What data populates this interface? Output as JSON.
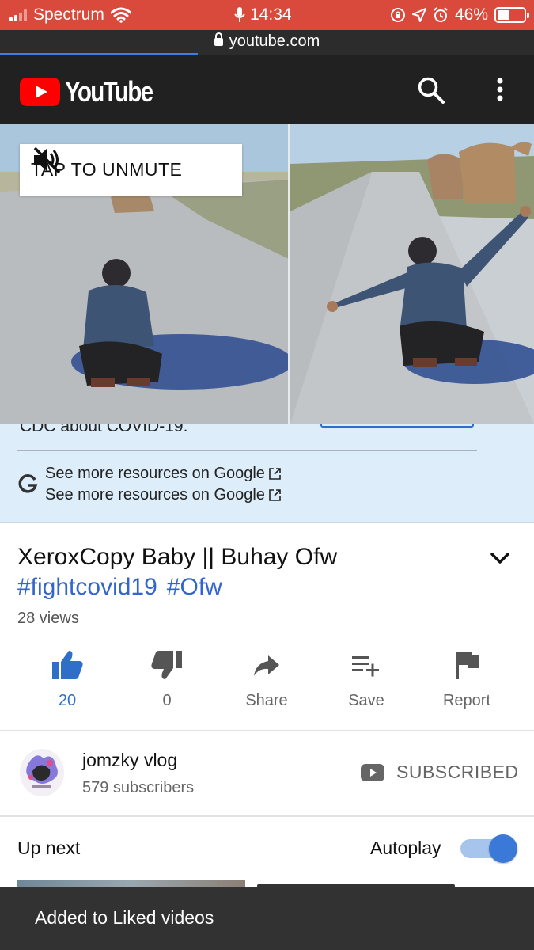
{
  "status_bar": {
    "carrier": "Spectrum",
    "time": "14:34",
    "battery_percent": "46%",
    "battery_level": 0.46,
    "icons": [
      "signal-icon",
      "wifi-icon",
      "mic-icon",
      "rotation-lock-icon",
      "location-icon",
      "alarm-icon",
      "battery-icon"
    ]
  },
  "browser": {
    "url": "youtube.com",
    "load_progress": 0.37
  },
  "header": {
    "logo_text": "YouTube",
    "icons": [
      "youtube-play-icon",
      "search-icon",
      "more-vert-icon"
    ]
  },
  "video": {
    "unmute_label": "TAP TO UNMUTE"
  },
  "info_panel": {
    "cdc_text": "CDC about COVID-19.",
    "resources": [
      "See more resources on Google",
      "See more resources on Google"
    ]
  },
  "video_info": {
    "title": "XeroxCopy Baby || Buhay Ofw",
    "hashtags": [
      "#fightcovid19",
      "#Ofw"
    ],
    "views": "28 views"
  },
  "actions": {
    "like": "20",
    "dislike": "0",
    "share": "Share",
    "save": "Save",
    "report": "Report"
  },
  "channel": {
    "name": "jomzky vlog",
    "subscribers": "579 subscribers",
    "subscribe_label": "SUBSCRIBED"
  },
  "up_next": {
    "label": "Up next",
    "autoplay_label": "Autoplay",
    "autoplay_on": true
  },
  "toast": {
    "message": "Added to Liked videos"
  },
  "colors": {
    "status_bar": "#d94a3d",
    "header": "#212121",
    "brand_red": "#ff0000",
    "link_blue": "#3366cc",
    "info_panel": "#ddeefa",
    "toast": "#323232"
  }
}
